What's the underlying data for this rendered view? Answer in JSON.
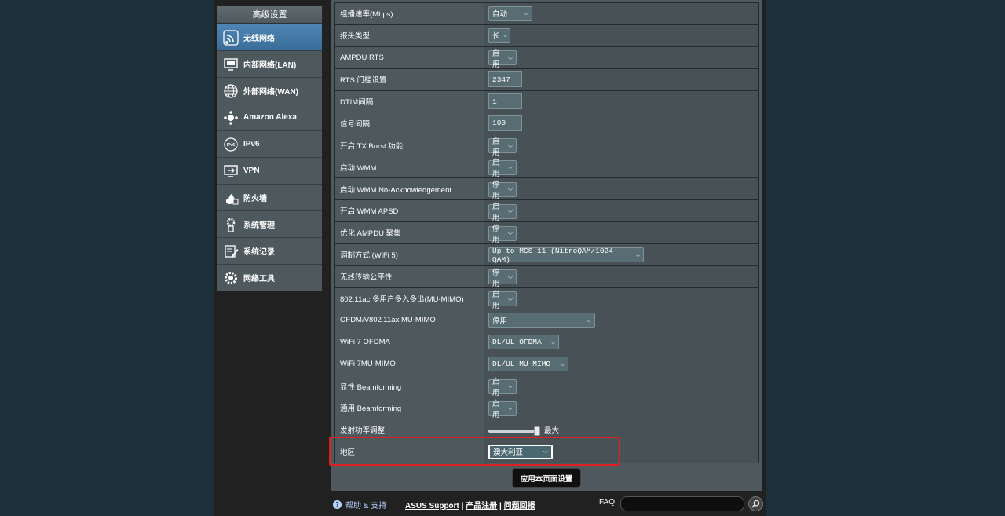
{
  "sidebar": {
    "header": "高级设置",
    "items": [
      {
        "label": "无线网络",
        "icon": "wireless-icon",
        "active": true
      },
      {
        "label": "内部网络(LAN)",
        "icon": "lan-monitor-icon"
      },
      {
        "label": "外部网络(WAN)",
        "icon": "globe-icon"
      },
      {
        "label": "Amazon Alexa",
        "icon": "alexa-network-icon"
      },
      {
        "label": "IPv6",
        "icon": "ipv6-globe-icon"
      },
      {
        "label": "VPN",
        "icon": "vpn-monitor-icon"
      },
      {
        "label": "防火墙",
        "icon": "firewall-flame-icon"
      },
      {
        "label": "系统管理",
        "icon": "admin-gear-icon"
      },
      {
        "label": "系统记录",
        "icon": "log-pencil-icon"
      },
      {
        "label": "网络工具",
        "icon": "network-tools-gear-icon"
      }
    ]
  },
  "settings": [
    {
      "label": "组播速率(Mbps)",
      "type": "select",
      "value": "自动",
      "width": 56
    },
    {
      "label": "报头类型",
      "type": "select",
      "value": "长",
      "width": 28
    },
    {
      "label": "AMPDU RTS",
      "type": "select",
      "value": "启用",
      "width": 36
    },
    {
      "label": "RTS 门槛设置",
      "type": "input",
      "value": "2347"
    },
    {
      "label": "DTIM间隔",
      "type": "input",
      "value": "1"
    },
    {
      "label": "信号间隔",
      "type": "input",
      "value": "100"
    },
    {
      "label": "开启 TX Burst 功能",
      "type": "select",
      "value": "启用",
      "width": 36
    },
    {
      "label": "启动 WMM",
      "type": "select",
      "value": "启用",
      "width": 36
    },
    {
      "label": "启动 WMM No-Acknowledgement",
      "type": "select",
      "value": "停用",
      "width": 36
    },
    {
      "label": "开启 WMM APSD",
      "type": "select",
      "value": "启用",
      "width": 36
    },
    {
      "label": "优化 AMPDU 聚集",
      "type": "select",
      "value": "停用",
      "width": 36
    },
    {
      "label": "调制方式 (WiFi 5)",
      "type": "select",
      "value": "Up to MCS 11 (NitroQAM/1024-QAM)",
      "width": 198,
      "mono": true
    },
    {
      "label": "无线传输公平性",
      "type": "select",
      "value": "停用",
      "width": 36
    },
    {
      "label": "802.11ac 多用户多入多出(MU-MIMO)",
      "type": "select",
      "value": "启用",
      "width": 36
    },
    {
      "label": "OFDMA/802.11ax MU-MIMO",
      "type": "select",
      "value": "停用",
      "width": 136
    },
    {
      "label": "WiFi 7 OFDMA",
      "type": "select",
      "value": "DL/UL OFDMA",
      "width": 90,
      "mono": true
    },
    {
      "label": "WiFi 7MU-MIMO",
      "type": "select",
      "value": "DL/UL MU-MIMO",
      "width": 102,
      "mono": true
    },
    {
      "label": "显性 Beamforming",
      "type": "select",
      "value": "启用",
      "width": 36
    },
    {
      "label": "通用 Beamforming",
      "type": "select",
      "value": "启用",
      "width": 36
    },
    {
      "label": "发射功率调整",
      "type": "slider",
      "value": "最大",
      "level": 1.0
    },
    {
      "label": "地区",
      "type": "select",
      "value": "澳大利亚",
      "width": 82,
      "highlight": true
    }
  ],
  "apply_label": "应用本页面设置",
  "footer": {
    "help_label": "帮助 & 支持",
    "asus_support": "ASUS Support",
    "product_register": "产品注册",
    "feedback": "问题回报",
    "separator": "|",
    "faq_label": "FAQ"
  },
  "colors": {
    "highlight": "#e02020",
    "active_nav": "#4e85b4",
    "panel": "#4d595d"
  }
}
